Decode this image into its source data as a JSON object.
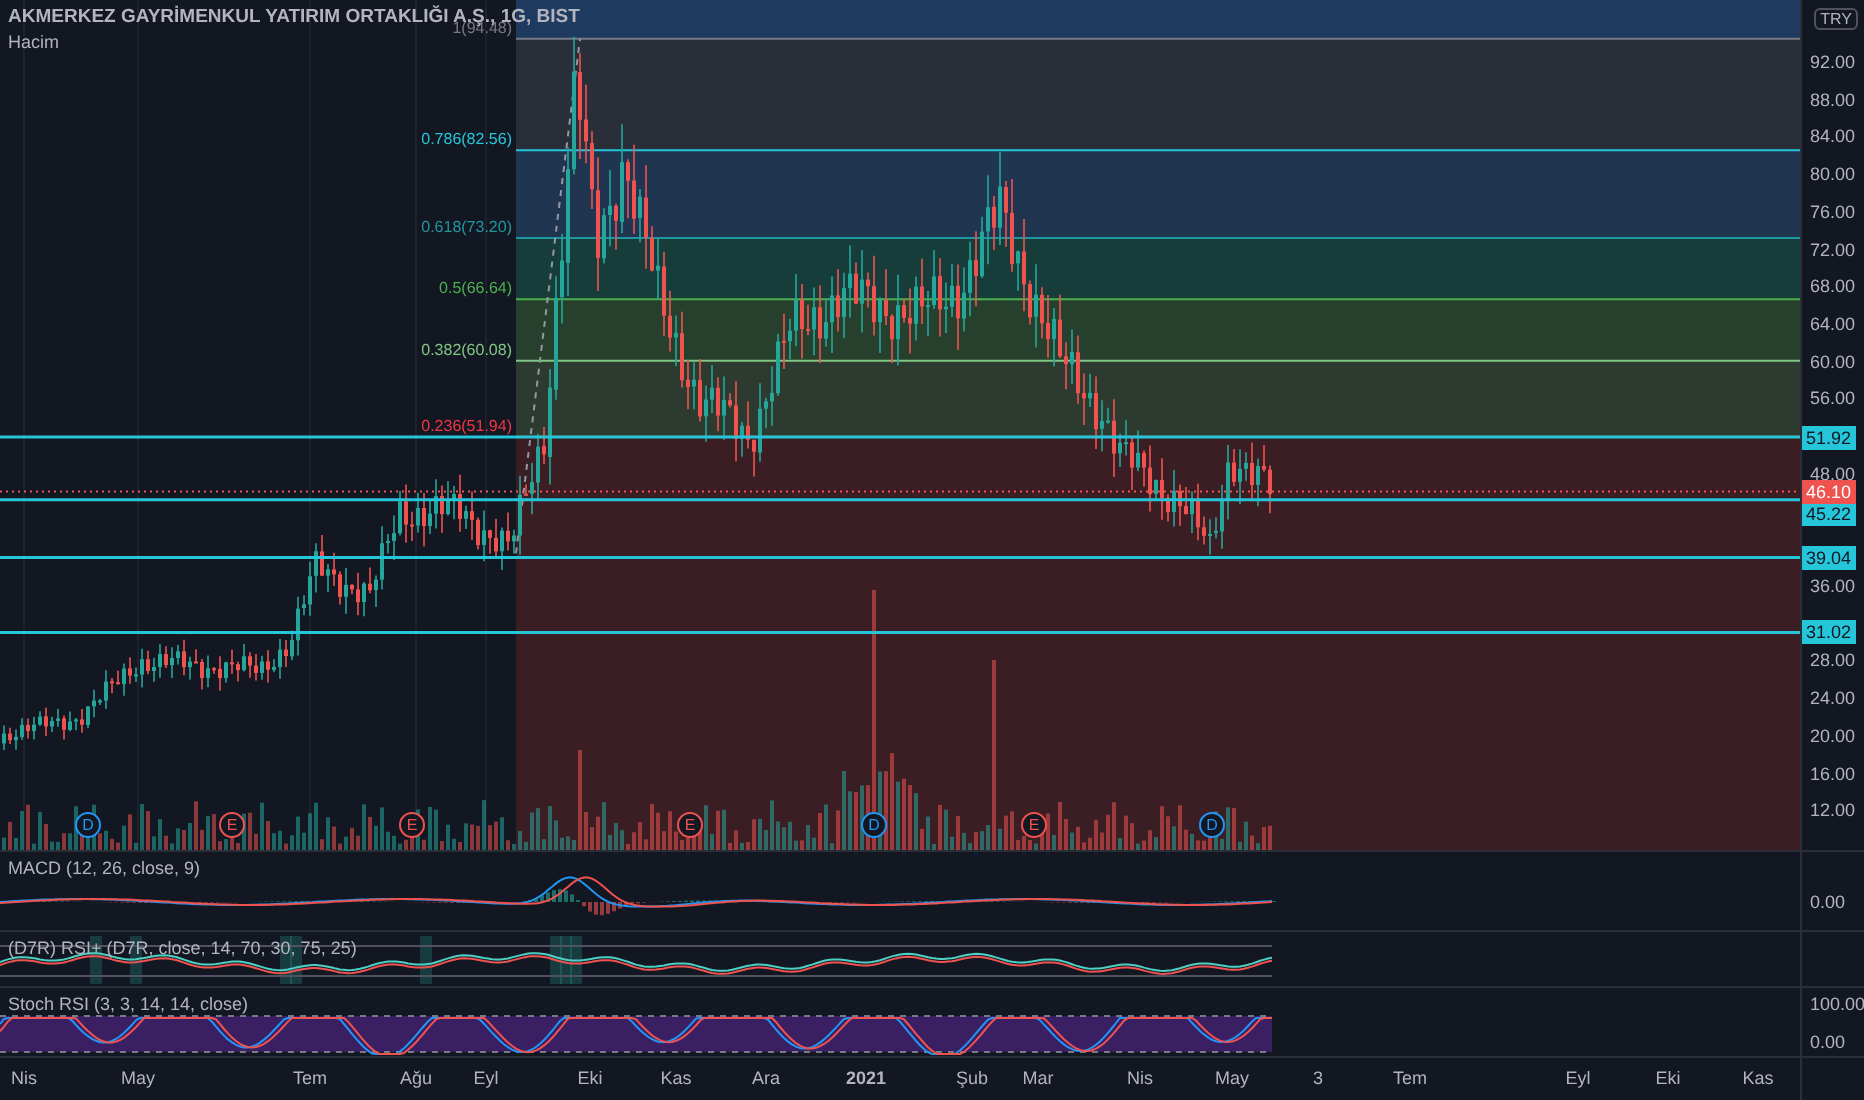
{
  "chart": {
    "title": "AKMERKEZ GAYRİMENKUL YATIRIM ORTAKLIĞI A.Ş., 1G, BIST",
    "volume_label": "Hacim",
    "currency": "TRY",
    "fib_levels": [
      {
        "label": "1(94.48)",
        "color": "#787b86"
      },
      {
        "label": "0.786(82.56)",
        "color": "#26c6da"
      },
      {
        "label": "0.618(73.20)",
        "color": "#2196a3"
      },
      {
        "label": "0.5(66.64)",
        "color": "#4caf50"
      },
      {
        "label": "0.382(60.08)",
        "color": "#81c784"
      },
      {
        "label": "0.236(51.94)",
        "color": "#f23645"
      }
    ],
    "horizontal_lines": [
      {
        "label": "51.92"
      },
      {
        "label": "45.22"
      },
      {
        "label": "39.04"
      },
      {
        "label": "31.02"
      }
    ],
    "last_price": "46.10",
    "price_ticks": [
      "92.00",
      "88.00",
      "84.00",
      "80.00",
      "76.00",
      "72.00",
      "68.00",
      "64.00",
      "60.00",
      "56.00",
      "48.00",
      "36.00",
      "28.00",
      "24.00",
      "20.00",
      "16.00",
      "12.00"
    ],
    "events": [
      {
        "letter": "D",
        "kind": "dividend"
      },
      {
        "letter": "E",
        "kind": "earnings"
      },
      {
        "letter": "E",
        "kind": "earnings"
      },
      {
        "letter": "E",
        "kind": "earnings"
      },
      {
        "letter": "D",
        "kind": "dividend"
      },
      {
        "letter": "E",
        "kind": "earnings"
      },
      {
        "letter": "D",
        "kind": "dividend"
      }
    ]
  },
  "indicators": [
    {
      "kind": "macd",
      "label": "MACD (12, 26, close, 9)",
      "ticks": [
        "0.00"
      ]
    },
    {
      "kind": "rsi",
      "label": "(D7R) RSI+ (D7R, close, 14, 70, 30, 75, 25)"
    },
    {
      "kind": "stoch",
      "label": "Stoch RSI (3, 3, 14, 14, close)",
      "ticks": [
        "100.00",
        "0.00"
      ]
    }
  ],
  "time_axis": [
    {
      "label": "Nis"
    },
    {
      "label": "May"
    },
    {
      "label": "Tem"
    },
    {
      "label": "Ağu"
    },
    {
      "label": "Eyl"
    },
    {
      "label": "Eki"
    },
    {
      "label": "Kas"
    },
    {
      "label": "Ara"
    },
    {
      "label": "2021",
      "bold": true
    },
    {
      "label": "Şub"
    },
    {
      "label": "Mar"
    },
    {
      "label": "Nis"
    },
    {
      "label": "May"
    },
    {
      "label": "3"
    },
    {
      "label": "Tem"
    },
    {
      "label": "Eyl"
    },
    {
      "label": "Eki"
    },
    {
      "label": "Kas"
    }
  ]
}
